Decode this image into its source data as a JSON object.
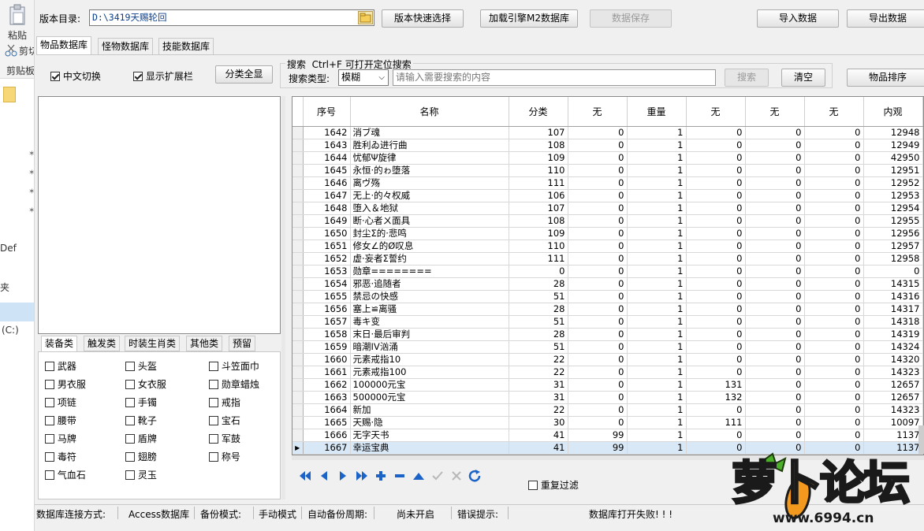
{
  "background_window": {
    "paste_label": "粘贴",
    "cut_label": "剪切",
    "clipboard_label": "剪贴板",
    "def_label": "Def",
    "folder_label": "夹",
    "drive_label": "(C:)"
  },
  "toolbar": {
    "version_dir_label": "版本目录:",
    "version_dir_value": "D:\\3419天赐轮回",
    "quick_select": "版本快速选择",
    "load_engine": "加载引擎M2数据库",
    "save_data": "数据保存",
    "import_data": "导入数据",
    "export_data": "导出数据"
  },
  "tabs": [
    "物品数据库",
    "怪物数据库",
    "技能数据库"
  ],
  "options": {
    "chinese_switch": "中文切换",
    "show_extension": "显示扩展栏",
    "show_all_categories": "分类全显"
  },
  "search": {
    "group_title": "搜索  Ctrl+F 可打开定位搜索",
    "type_label": "搜索类型:",
    "type_value": "模糊",
    "placeholder": "请输入需要搜索的内容",
    "search_button": "搜索",
    "clear_button": "清空",
    "sort_button": "物品排序"
  },
  "category_tabs": [
    "装备类",
    "触发类",
    "时装生肖类",
    "其他类",
    "预留"
  ],
  "categories": [
    [
      "武器",
      "头盔",
      "斗笠面巾"
    ],
    [
      "男衣服",
      "女衣服",
      "勋章蜡烛"
    ],
    [
      "项链",
      "手镯",
      "戒指"
    ],
    [
      "腰带",
      "靴子",
      "宝石"
    ],
    [
      "马牌",
      "盾牌",
      "军鼓"
    ],
    [
      "毒符",
      "翅膀",
      "称号"
    ],
    [
      "气血石",
      "灵玉",
      ""
    ]
  ],
  "grid": {
    "columns": [
      "序号",
      "名称",
      "分类",
      "无",
      "重量",
      "无",
      "无",
      "无",
      "内观"
    ],
    "rows": [
      [
        "1642",
        "消ブ魂",
        "107",
        "0",
        "1",
        "0",
        "0",
        "0",
        "12948"
      ],
      [
        "1643",
        "胜利ゐ进行曲",
        "108",
        "0",
        "1",
        "0",
        "0",
        "0",
        "12949"
      ],
      [
        "1644",
        "忧郁Ψ旋律",
        "109",
        "0",
        "1",
        "0",
        "0",
        "0",
        "42950"
      ],
      [
        "1645",
        "永恒·的ゎ堕落",
        "110",
        "0",
        "1",
        "0",
        "0",
        "0",
        "12951"
      ],
      [
        "1646",
        "离ヴ殇",
        "111",
        "0",
        "1",
        "0",
        "0",
        "0",
        "12952"
      ],
      [
        "1647",
        "无上·的々权威",
        "106",
        "0",
        "1",
        "0",
        "0",
        "0",
        "12953"
      ],
      [
        "1648",
        "堕入＆地狱",
        "107",
        "0",
        "1",
        "0",
        "0",
        "0",
        "12954"
      ],
      [
        "1649",
        "断·心者ㄨ面具",
        "108",
        "0",
        "1",
        "0",
        "0",
        "0",
        "12955"
      ],
      [
        "1650",
        "封尘Σ的·悲鸣",
        "109",
        "0",
        "1",
        "0",
        "0",
        "0",
        "12956"
      ],
      [
        "1651",
        "修女∠的Ø叹息",
        "110",
        "0",
        "1",
        "0",
        "0",
        "0",
        "12957"
      ],
      [
        "1652",
        "虚·妄者Σ誓约",
        "111",
        "0",
        "1",
        "0",
        "0",
        "0",
        "12958"
      ],
      [
        "1653",
        "勋章========",
        "0",
        "0",
        "1",
        "0",
        "0",
        "0",
        "0"
      ],
      [
        "1654",
        "邪恶·追随者",
        "28",
        "0",
        "1",
        "0",
        "0",
        "0",
        "14315"
      ],
      [
        "1655",
        "禁忌の快感",
        "51",
        "0",
        "1",
        "0",
        "0",
        "0",
        "14316"
      ],
      [
        "1656",
        "塞上≌离骚",
        "28",
        "0",
        "1",
        "0",
        "0",
        "0",
        "14317"
      ],
      [
        "1657",
        "毒キ变",
        "51",
        "0",
        "1",
        "0",
        "0",
        "0",
        "14318"
      ],
      [
        "1658",
        "末日·最后审判",
        "28",
        "0",
        "1",
        "0",
        "0",
        "0",
        "14319"
      ],
      [
        "1659",
        "暗潮IV汹涌",
        "51",
        "0",
        "1",
        "0",
        "0",
        "0",
        "14324"
      ],
      [
        "1660",
        "元素戒指10",
        "22",
        "0",
        "1",
        "0",
        "0",
        "0",
        "14320"
      ],
      [
        "1661",
        "元素戒指100",
        "22",
        "0",
        "1",
        "0",
        "0",
        "0",
        "14323"
      ],
      [
        "1662",
        "100000元宝",
        "31",
        "0",
        "1",
        "131",
        "0",
        "0",
        "12657"
      ],
      [
        "1663",
        "500000元宝",
        "31",
        "0",
        "1",
        "132",
        "0",
        "0",
        "12657"
      ],
      [
        "1664",
        "新加",
        "22",
        "0",
        "1",
        "0",
        "0",
        "0",
        "14323"
      ],
      [
        "1665",
        "天赐·隐",
        "30",
        "0",
        "1",
        "111",
        "0",
        "0",
        "10097"
      ],
      [
        "1666",
        "无字天书",
        "41",
        "99",
        "1",
        "0",
        "0",
        "0",
        "1137"
      ],
      [
        "1667",
        "幸运宝典",
        "41",
        "99",
        "1",
        "0",
        "0",
        "0",
        "1137"
      ]
    ],
    "selected_row": 25
  },
  "nav_icons": [
    "first-icon",
    "prior-icon",
    "next-icon",
    "last-icon",
    "insert-icon",
    "delete-icon",
    "edit-icon",
    "post-icon",
    "cancel-icon",
    "refresh-icon"
  ],
  "repeat_filter": "重复过滤",
  "status_bar": {
    "conn_label": "数据库连接方式:",
    "conn_value": "Access数据库",
    "backup_label": "备份模式:",
    "backup_value": "手动模式",
    "auto_label": "自动备份周期:",
    "auto_value": "尚未开启",
    "error_label": "错误提示:",
    "error_value": "数据库打开失败! ! !"
  },
  "watermark": {
    "text": "萝卜论坛",
    "url": "www.6994.cn"
  },
  "colors": {
    "accent": "#0b5fb4",
    "selected_row": "#d9e8f6",
    "nav_blue": "#1b63c6"
  }
}
